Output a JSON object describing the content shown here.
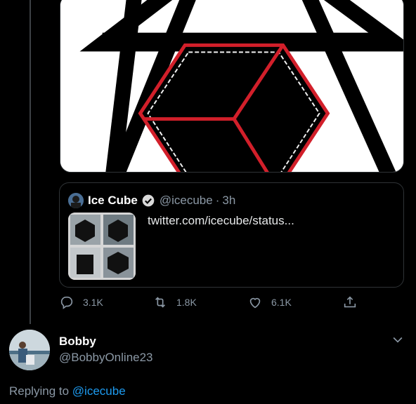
{
  "quote": {
    "name": "Ice Cube",
    "handle": "@icecube",
    "separator": "·",
    "time": "3h",
    "link": "twitter.com/icecube/status..."
  },
  "actions": {
    "replies": "3.1K",
    "retweets": "1.8K",
    "likes": "6.1K"
  },
  "reply_user": {
    "name": "Bobby",
    "handle": "@BobbyOnline23"
  },
  "replying": {
    "prefix": "Replying to",
    "target": "@icecube"
  },
  "colors": {
    "background": "#000000",
    "link": "#1d9bf0",
    "muted": "#8b98a5",
    "border": "#2f3336",
    "hexagon_red": "#d21f2a"
  },
  "icons": [
    "reply-icon",
    "retweet-icon",
    "like-icon",
    "share-icon",
    "verified-badge-icon",
    "chevron-down-icon"
  ]
}
